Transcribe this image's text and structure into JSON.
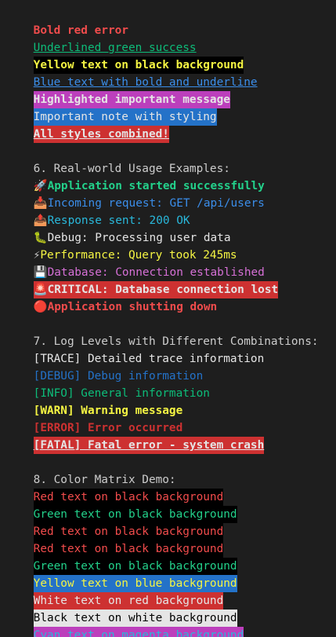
{
  "lines": {
    "bold_red": "Bold red error",
    "underlined_green": "Underlined green success",
    "yellow_on_black": "Yellow text on black background",
    "blue_bold_underline": "Blue text with bold and underline",
    "highlighted": "Highlighted important message",
    "important_note": "Important note with styling",
    "all_combined": "All styles combined!"
  },
  "section6": {
    "heading": "6. Real-world Usage Examples:",
    "app_started_icon": "🚀",
    "app_started": "Application started successfully",
    "incoming_icon": "📥",
    "incoming": "Incoming request: GET /api/users",
    "response_icon": "📤",
    "response": "Response sent: 200 OK",
    "debug_icon": "🐛",
    "debug": "Debug: Processing user data",
    "perf_icon": "⚡",
    "perf": "Performance: Query took 245ms",
    "db_icon": "💾",
    "db": "Database: Connection established",
    "critical_icon": "🚨",
    "critical": "CRITICAL: Database connection lost",
    "shutdown_icon": "🔴",
    "shutdown": "Application shutting down"
  },
  "section7": {
    "heading": "7. Log Levels with Different Combinations:",
    "trace": "[TRACE] Detailed trace information",
    "debug": "[DEBUG] Debug information",
    "info": "[INFO] General information",
    "warn": "[WARN] Warning message",
    "error": "[ERROR] Error occurred",
    "fatal": "[FATAL] Fatal error - system crash"
  },
  "section8": {
    "heading": "8. Color Matrix Demo:",
    "rows": [
      "Red text on black background",
      "Green text on black background",
      "Red text on black background",
      "Red text on black background",
      "Green text on black background",
      "Yellow text on blue background",
      "White text on red background",
      "Black text on white background",
      "Cyan text on magenta background"
    ]
  },
  "colors": {
    "terminal_bg": "#1e1e1e",
    "red": "#f14c4c",
    "green": "#23d18b",
    "yellow": "#f5f543",
    "blue": "#3b8eea",
    "magenta": "#d670d6",
    "bg_red": "#cd3131",
    "bg_blue": "#2472c8",
    "bg_magenta": "#bc3fbc"
  }
}
